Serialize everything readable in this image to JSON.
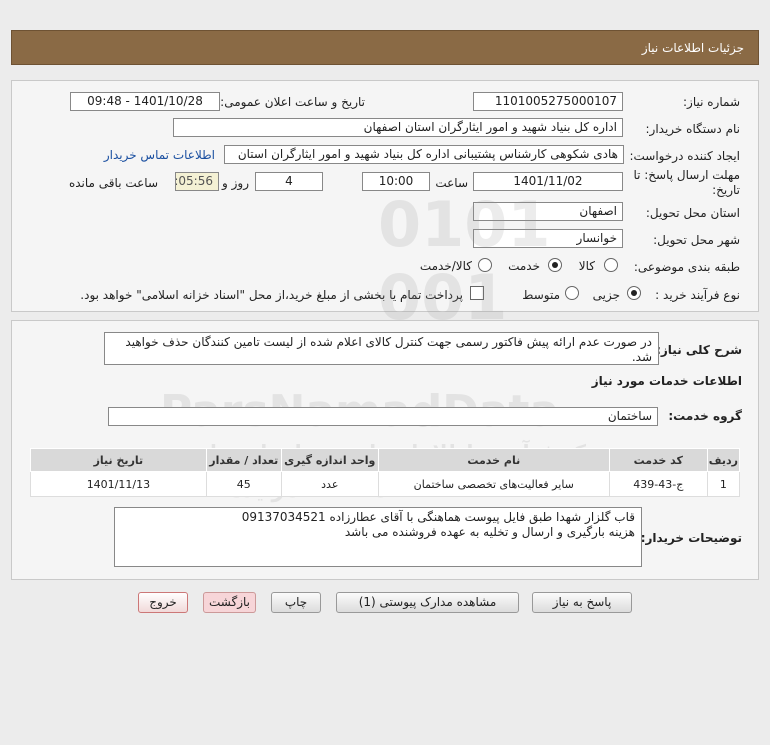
{
  "header": {
    "title": "جزئیات اطلاعات نیاز"
  },
  "form": {
    "need_number_label": "شماره نیاز:",
    "need_number": "1101005275000107",
    "announce_label": "تاریخ و ساعت اعلان عمومی:",
    "announce_value": "1401/10/28 - 09:48",
    "buyer_org_label": "نام دستگاه خریدار:",
    "buyer_org": "اداره کل بنیاد شهید و امور ایثارگران استان اصفهان",
    "requester_label": "ایجاد کننده درخواست:",
    "requester": "هادی شکوهی کارشناس پشتیبانی اداره کل بنیاد شهید و امور ایثارگران استان",
    "contact_link": "اطلاعات تماس خریدار",
    "deadline_label": "مهلت ارسال پاسخ: تا",
    "deadline_label2": "تاریخ:",
    "deadline_date": "1401/11/02",
    "time_label": "ساعت",
    "deadline_time": "10:00",
    "days_value": "4",
    "days_label": "روز و",
    "remaining_time": "00:05:56",
    "remaining_label": "ساعت باقی مانده",
    "delivery_place_label": "استان محل تحویل:",
    "delivery_place": "اصفهان",
    "delivery_city_label": "شهر محل تحویل:",
    "delivery_city": "خوانسار",
    "category_label": "طبقه بندی موضوعی:",
    "category_options": [
      "کالا",
      "خدمت",
      "کالا/خدمت"
    ],
    "category_selected": "خدمت",
    "process_label": "نوع فرآیند خرید :",
    "process_options": [
      "جزیی",
      "متوسط"
    ],
    "process_selected": "جزیی",
    "payment_note": "پرداخت تمام یا بخشی از مبلغ خرید،از محل \"اسناد خزانه اسلامی\" خواهد بود."
  },
  "details": {
    "summary_label": "شرح کلی نیاز:",
    "summary": "در صورت عدم ارائه پیش فاکتور رسمی جهت کنترل کالای اعلام شده از لیست تامین کنندگان حذف خواهید شد.",
    "services_heading": "اطلاعات خدمات مورد نیاز",
    "service_group_label": "گروه خدمت:",
    "service_group": "ساختمان",
    "table": {
      "headers": [
        "ردیف",
        "کد خدمت",
        "نام خدمت",
        "واحد اندازه گیری",
        "تعداد / مقدار",
        "تاریخ نیاز"
      ],
      "rows": [
        [
          "1",
          "ج-43-439",
          "سایر فعالیت‌های تخصصی ساختمان",
          "عدد",
          "45",
          "1401/11/13"
        ]
      ]
    },
    "buyer_notes_label": "توضیحات خریدار:",
    "buyer_notes_line1": "قاب گلزار شهدا طبق فایل پیوست هماهنگی با آقای عطارزاده 09137034521",
    "buyer_notes_line2": "هزینه بارگیری و ارسال و تخلیه به عهده فروشنده می باشد"
  },
  "buttons": {
    "reply": "پاسخ به نیاز",
    "attachments": "مشاهده مدارک پیوستی (1)",
    "print": "چاپ",
    "back": "بازگشت",
    "exit": "خروج"
  },
  "watermark": {
    "brand": "ParsNamadData",
    "tagline": "مرکز فرآوری اطلاعات پارس نماد داده ها",
    "tagline2": "مناقصه مزایده",
    "phone": "۰۲۱-۸۸۳۴۹۶۷۰"
  }
}
